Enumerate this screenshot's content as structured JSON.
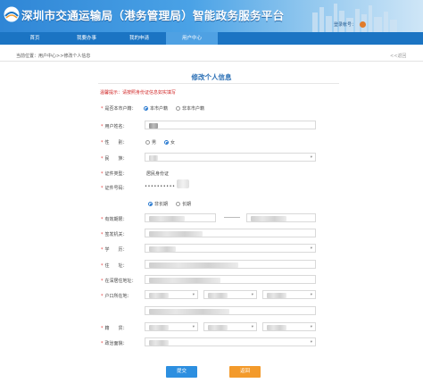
{
  "header": {
    "title": "深圳市交通运输局（港务管理局）智能政务服务平台",
    "login_label": "登录帐号："
  },
  "nav": {
    "items": [
      "首页",
      "我要办事",
      "我的申请",
      "用户中心"
    ],
    "active_index": 3
  },
  "breadcrumb": {
    "text": "当前位置：用户中心>>修改个人信息",
    "back": "<<返回"
  },
  "form": {
    "title": "修改个人信息",
    "tip": "温馨提示：请按照身份证信息如实填写",
    "is_local_label": "是否本市户籍：",
    "is_local_options": [
      "本市户籍",
      "非本市户籍"
    ],
    "is_local_selected": 0,
    "name_label": "用户姓名：",
    "gender_label": "性　　别：",
    "gender_options": [
      "男",
      "女"
    ],
    "gender_selected": 1,
    "ethnicity_label": "民　　族：",
    "id_type_label": "证件类型：",
    "id_type_value": "居民身份证",
    "id_number_label": "证件号码：",
    "id_number_value": "••••••••••",
    "validity_options": [
      "非长期",
      "长期"
    ],
    "validity_selected": 0,
    "valid_period_label": "有效期限：",
    "issuer_label": "签发机关：",
    "education_label": "学　　历：",
    "address_label": "住　　址：",
    "residence_label": "在深居住地址：",
    "household_label": "户口所在地：",
    "native_place_label": "籍　　贯：",
    "political_label": "政治面貌："
  },
  "buttons": {
    "submit": "提交",
    "return": "返回"
  },
  "colors": {
    "nav": "#1b74c3",
    "accent": "#2a6fb5",
    "tip": "#d12a2a",
    "submit": "#2d8fe0",
    "return": "#f39a2b"
  }
}
